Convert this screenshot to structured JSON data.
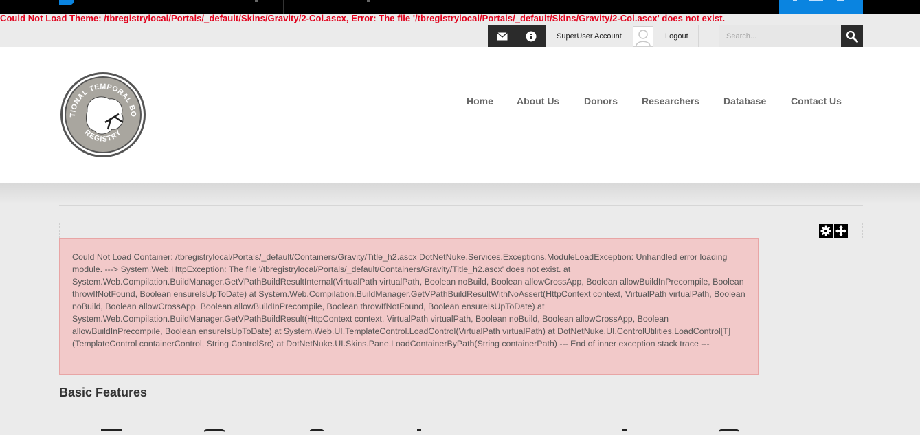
{
  "theme_error": "Could Not Load Theme: /tbregistrylocal/Portals/_default/Skins/Gravity/2-Col.ascx, Error: The file '/tbregistrylocal/Portals/_default/Skins/Gravity/2-Col.ascx' does not exist.",
  "user_bar": {
    "account_label": "SuperUser Account",
    "logout_label": "Logout",
    "search_placeholder": "Search..."
  },
  "logo": {
    "text_top": "NATIONAL TEMPORAL BONE",
    "text_bottom": "REGISTRY"
  },
  "nav": [
    "Home",
    "About Us",
    "Donors",
    "Researchers",
    "Database",
    "Contact Us"
  ],
  "container_error": "Could Not Load Container: /tbregistrylocal/Portals/_default/Containers/Gravity/Title_h2.ascx DotNetNuke.Services.Exceptions.ModuleLoadException: Unhandled error loading module. ---> System.Web.HttpException: The file '/tbregistrylocal/Portals/_default/Containers/Gravity/Title_h2.ascx' does not exist. at System.Web.Compilation.BuildManager.GetVPathBuildResultInternal(VirtualPath virtualPath, Boolean noBuild, Boolean allowCrossApp, Boolean allowBuildInPrecompile, Boolean throwIfNotFound, Boolean ensureIsUpToDate) at System.Web.Compilation.BuildManager.GetVPathBuildResultWithNoAssert(HttpContext context, VirtualPath virtualPath, Boolean noBuild, Boolean allowCrossApp, Boolean allowBuildInPrecompile, Boolean throwIfNotFound, Boolean ensureIsUpToDate) at System.Web.Compilation.BuildManager.GetVPathBuildResult(HttpContext context, VirtualPath virtualPath, Boolean noBuild, Boolean allowCrossApp, Boolean allowBuildInPrecompile, Boolean ensureIsUpToDate) at System.Web.UI.TemplateControl.LoadControl(VirtualPath virtualPath) at DotNetNuke.UI.ControlUtilities.LoadControl[T](TemplateControl containerControl, String ControlSrc) at DotNetNuke.UI.Skins.Pane.LoadContainerByPath(String containerPath) --- End of inner exception stack trace ---",
  "section_title": "Basic Features",
  "icons": {
    "messages": "envelope-icon",
    "notifications": "info-icon",
    "search": "search-icon",
    "pane_settings": "gear-icon",
    "pane_move": "move-icon"
  },
  "colors": {
    "theme_error": "#e0001b",
    "error_box_bg": "#f2c9c9",
    "dnn_blue": "#0a84e0",
    "dark_button": "#2b2b2b"
  }
}
